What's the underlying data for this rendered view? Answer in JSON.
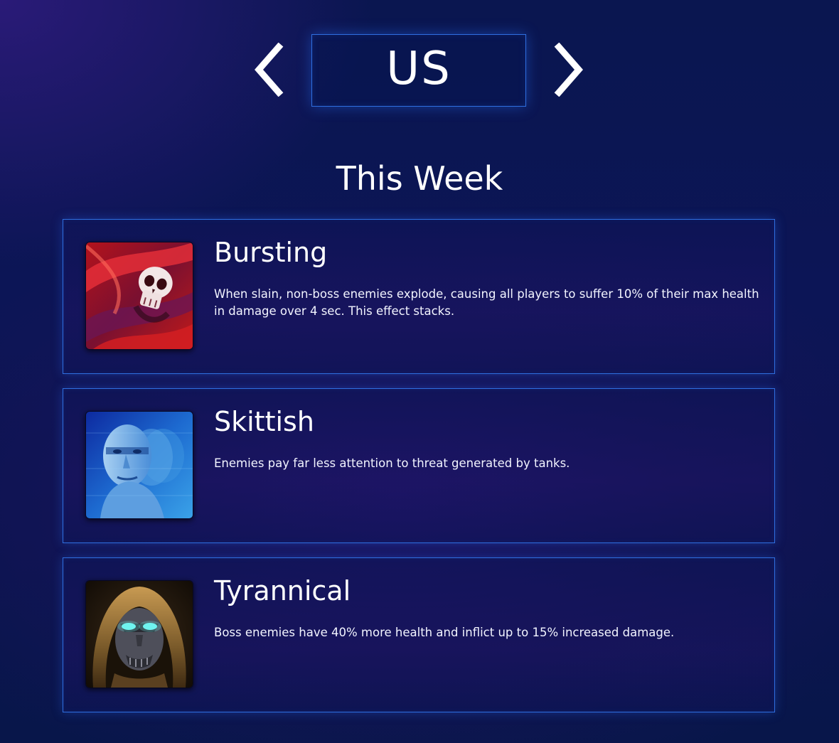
{
  "region": {
    "label": "US",
    "prev_icon": "chevron-left-icon",
    "next_icon": "chevron-right-icon"
  },
  "section": {
    "title": "This Week"
  },
  "affixes": [
    {
      "name": "Bursting",
      "description": "When slain, non-boss enemies explode, causing all players to suffer 10% of their max health in damage over 4 sec. This effect stacks.",
      "icon": "bursting-skull-icon"
    },
    {
      "name": "Skittish",
      "description": "Enemies pay far less attention to threat generated by tanks.",
      "icon": "skittish-face-icon"
    },
    {
      "name": "Tyrannical",
      "description": "Boss enemies have 40% more health and inflict up to 15% increased damage.",
      "icon": "tyrannical-hooded-icon"
    }
  ],
  "colors": {
    "accent_border": "#2f6fe0",
    "background_dark": "#0a1650",
    "background_purple": "#2a1a78",
    "text": "#ffffff"
  }
}
